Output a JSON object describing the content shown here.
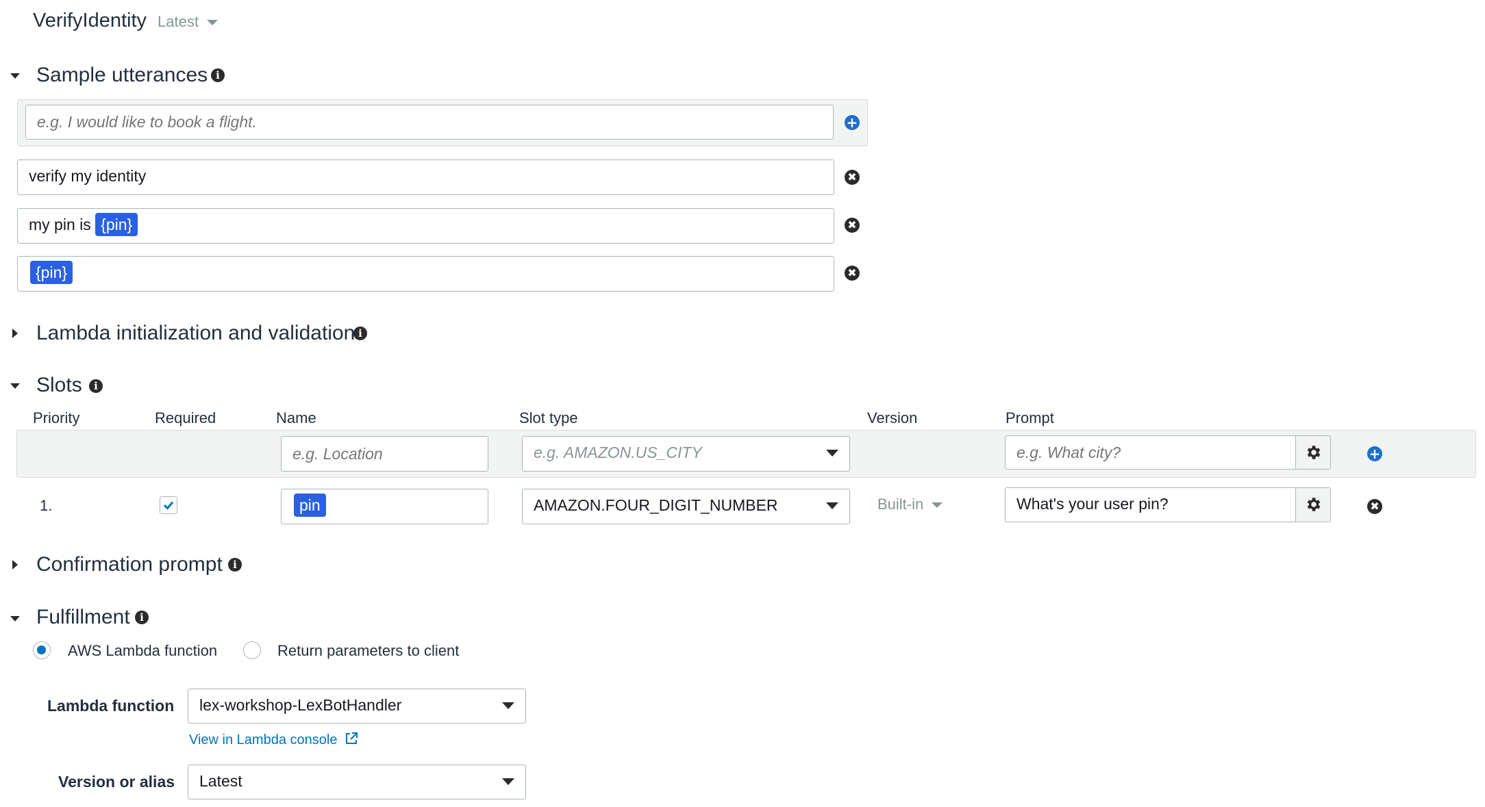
{
  "intent": {
    "name": "VerifyIdentity",
    "version": "Latest"
  },
  "sample_utterances": {
    "title": "Sample utterances",
    "placeholder": "e.g. I would like to book a flight.",
    "items": [
      {
        "prefix": "verify my identity",
        "slot": ""
      },
      {
        "prefix": "my pin is ",
        "slot": "{pin}"
      },
      {
        "prefix": "",
        "slot": "{pin}"
      }
    ],
    "remove_icon": "✖",
    "add_icon": "+"
  },
  "lambda_init": {
    "title": "Lambda initialization and validation"
  },
  "slots": {
    "title": "Slots",
    "columns": [
      "Priority",
      "Required",
      "Name",
      "Slot type",
      "Version",
      "Prompt"
    ],
    "new_row": {
      "name_placeholder": "e.g. Location",
      "type_placeholder": "e.g. AMAZON.US_CITY",
      "prompt_placeholder": "e.g. What city?"
    },
    "rows": [
      {
        "priority": "1.",
        "required": true,
        "name": "pin",
        "slot_type": "AMAZON.FOUR_DIGIT_NUMBER",
        "version": "Built-in",
        "prompt": "What's your user pin?"
      }
    ]
  },
  "confirmation_prompt": {
    "title": "Confirmation prompt"
  },
  "fulfillment": {
    "title": "Fulfillment",
    "options": [
      "AWS Lambda function",
      "Return parameters to client"
    ],
    "selected": 0,
    "lambda_function_label": "Lambda function",
    "lambda_function_value": "lex-workshop-LexBotHandler",
    "console_link": "View in Lambda console",
    "version_label": "Version or alias",
    "version_value": "Latest"
  },
  "colors": {
    "slot_chip": "#2a61e0",
    "link": "#0073bb",
    "add_icon": "#1f6fc7"
  },
  "icons": [
    "info-icon",
    "gear-icon",
    "close-icon",
    "add-icon",
    "checkbox-icon",
    "external-link-icon",
    "caret-down-icon",
    "caret-right-icon"
  ]
}
